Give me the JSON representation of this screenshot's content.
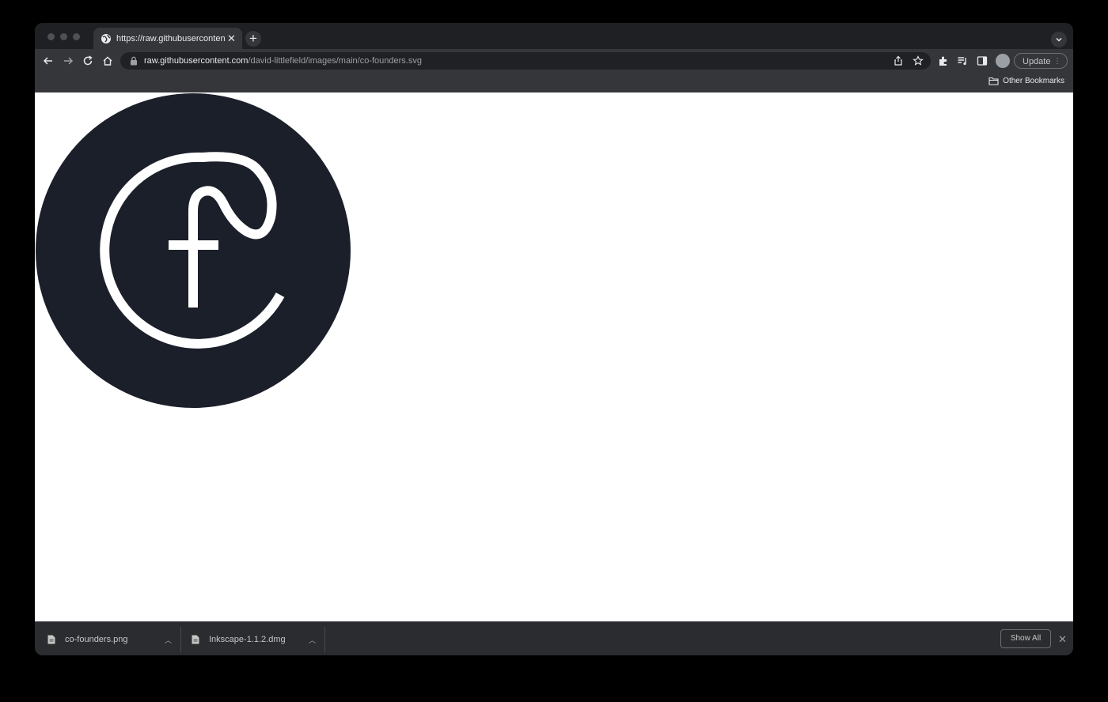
{
  "tab": {
    "title": "https://raw.githubusercontent.com/david-littlefield/images/main/co-founders.svg"
  },
  "omnibox": {
    "host": "raw.githubusercontent.com",
    "path": "/david-littlefield/images/main/co-founders.svg"
  },
  "toolbar": {
    "update_label": "Update"
  },
  "bookmarks": {
    "other_label": "Other Bookmarks"
  },
  "downloads": {
    "items": [
      {
        "name": "co-founders.png"
      },
      {
        "name": "Inkscape-1.1.2.dmg"
      }
    ],
    "show_all_label": "Show All"
  },
  "logo": {
    "background_color": "#1b1f2a",
    "stroke_color": "#ffffff"
  }
}
